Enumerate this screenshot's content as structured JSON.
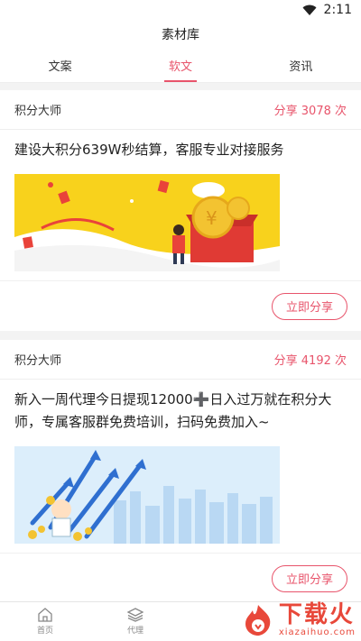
{
  "status": {
    "time": "2:11"
  },
  "header": {
    "title": "素材库"
  },
  "tabs": [
    {
      "label": "文案"
    },
    {
      "label": "软文"
    },
    {
      "label": "资讯"
    }
  ],
  "cards": [
    {
      "author": "积分大师",
      "share_count": "分享 3078 次",
      "text": "建设大积分639W秒结算，客服专业对接服务",
      "share_button": "立即分享"
    },
    {
      "author": "积分大师",
      "share_count": "分享 4192 次",
      "text": "新入一周代理今日提现12000➕日入过万就在积分大师，专属客服群免费培训，扫码免费加入~",
      "share_button": "立即分享"
    }
  ],
  "bottom_nav": [
    {
      "label": "首页",
      "icon": "home-icon"
    },
    {
      "label": "代理",
      "icon": "layers-icon"
    },
    {
      "label": "",
      "icon": ""
    },
    {
      "label": "",
      "icon": ""
    }
  ],
  "watermark": {
    "main": "下载火",
    "sub": "xiazaihuo.com"
  },
  "colors": {
    "accent": "#e8546b",
    "watermark": "#e8483a"
  }
}
